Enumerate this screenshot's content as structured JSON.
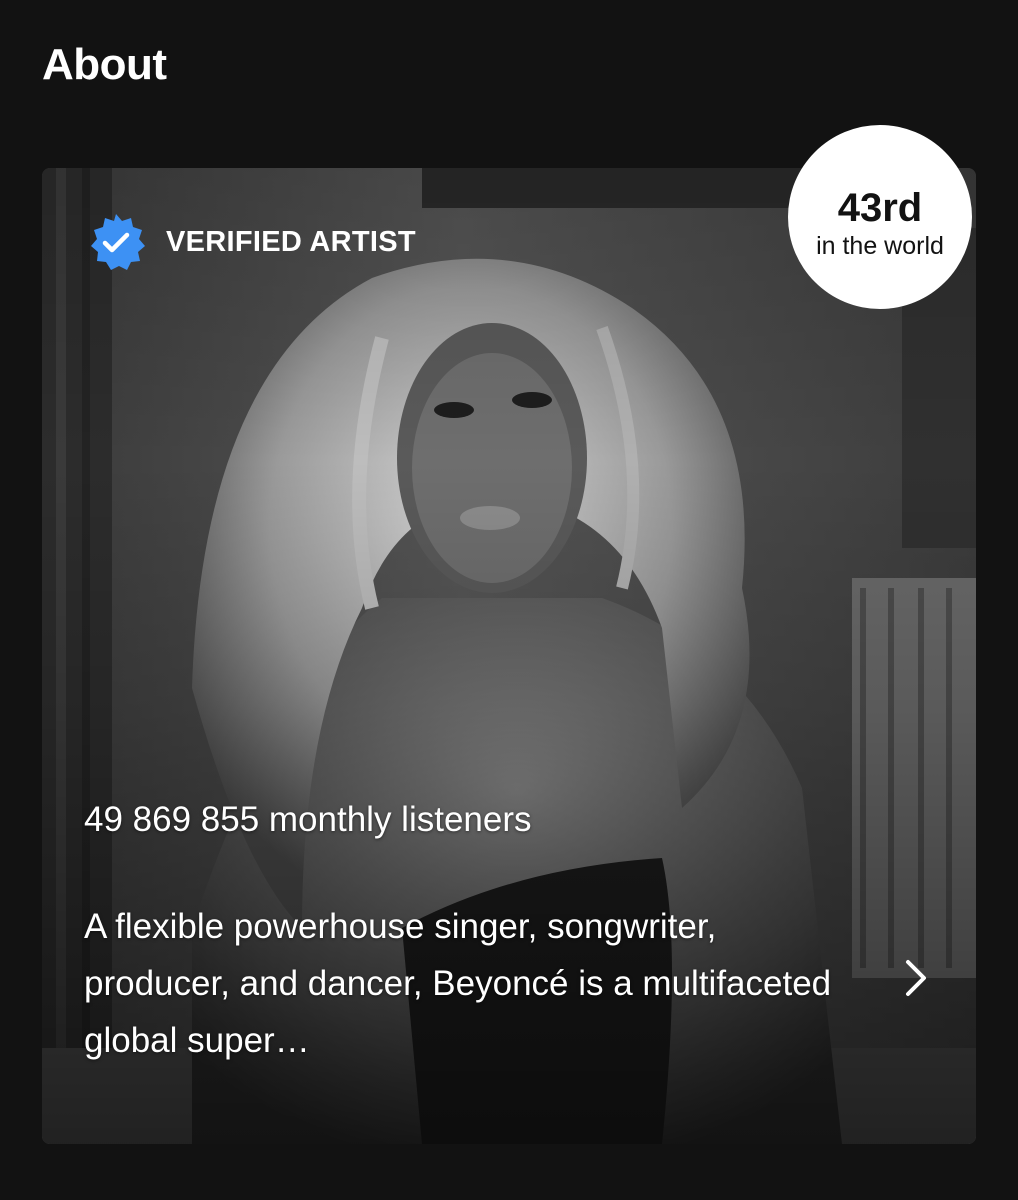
{
  "section": {
    "title": "About"
  },
  "card": {
    "verified": {
      "label": "VERIFIED ARTIST",
      "icon": "verified-badge-icon",
      "color": "#3d91f4"
    },
    "rank": {
      "value": "43rd",
      "caption": "in the world"
    },
    "listeners_text": "49 869 855 monthly listeners",
    "bio_text": "A flexible powerhouse singer, songwriter, producer, and dancer, Beyoncé is a multifaceted global super…",
    "chevron_icon": "chevron-right-icon"
  },
  "colors": {
    "background": "#121212",
    "text": "#ffffff",
    "badge_bg": "#ffffff",
    "badge_text": "#121212"
  }
}
